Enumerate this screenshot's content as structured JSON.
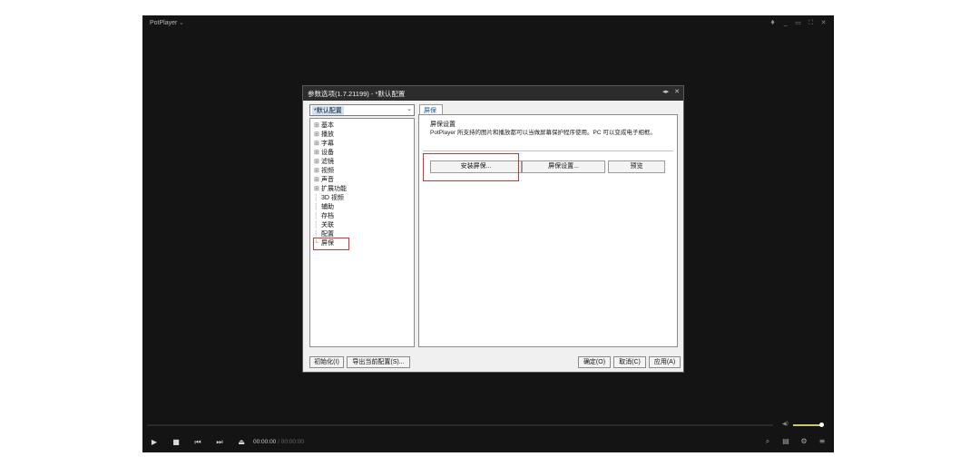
{
  "player": {
    "title": "PotPlayer",
    "title_chevron": "⌄",
    "window_controls": [
      "♦",
      "_",
      "▭",
      "⛶",
      "✕"
    ],
    "time_current": "00:00:00",
    "time_separator": "/",
    "time_total": "00:00:00",
    "volume_level": 0.75,
    "playback_controls": [
      "play-icon",
      "stop-icon",
      "prev-icon",
      "next-icon",
      "eject-icon"
    ],
    "right_controls": [
      "3d-icon",
      "playlist-icon",
      "settings-icon",
      "menu-icon"
    ]
  },
  "dialog": {
    "title": "参数选项(1.7.21199) - *默认配置",
    "preset_value": "*默认配置",
    "tree": [
      {
        "label": "基本",
        "expandable": true
      },
      {
        "label": "播放",
        "expandable": true
      },
      {
        "label": "字幕",
        "expandable": true
      },
      {
        "label": "设备",
        "expandable": true
      },
      {
        "label": "滤镜",
        "expandable": true
      },
      {
        "label": "视频",
        "expandable": true
      },
      {
        "label": "声音",
        "expandable": true
      },
      {
        "label": "扩展功能",
        "expandable": true
      },
      {
        "label": "3D 视频",
        "expandable": false
      },
      {
        "label": "辅助",
        "expandable": false
      },
      {
        "label": "存档",
        "expandable": false
      },
      {
        "label": "关联",
        "expandable": false
      },
      {
        "label": "配置",
        "expandable": false
      },
      {
        "label": "屏保",
        "expandable": false,
        "selected": true
      }
    ],
    "tab_label": "屏保",
    "group_label": "屏保设置",
    "description": "PotPlayer 所支持的图片和播放都可以当做屏幕保护程序使用。PC 可以变成电子相框。",
    "buttons": {
      "install": "安装屏保...",
      "settings": "屏保设置...",
      "preview": "预览"
    },
    "bottom_buttons": {
      "init": "初始化(I)",
      "export": "导出当前配置(S)...",
      "ok": "确定(O)",
      "cancel": "取消(C)",
      "apply": "应用(A)"
    }
  },
  "colors": {
    "highlight": "#d93030",
    "player_bg": "#141414",
    "volume_accent": "#cfc56b"
  }
}
